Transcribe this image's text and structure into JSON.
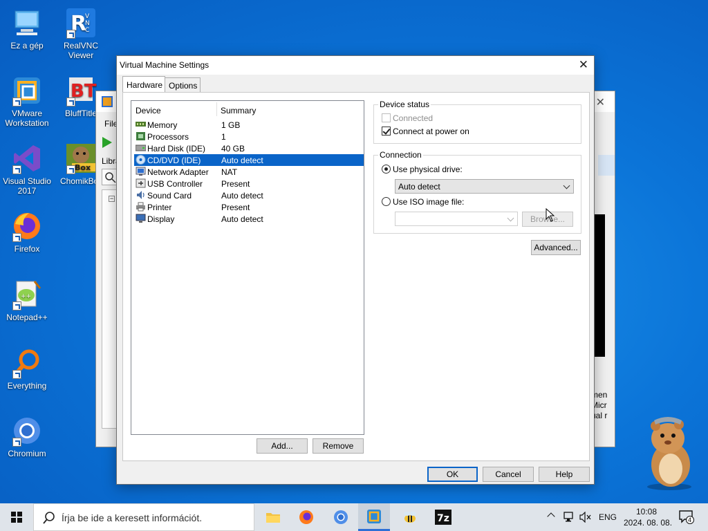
{
  "desktop": {
    "icons": [
      {
        "label": "Ez a gép"
      },
      {
        "label": "RealVNC Viewer"
      },
      {
        "label": "VMware Workstation"
      },
      {
        "label": "BluffTitle"
      },
      {
        "label": "Visual Studio 2017"
      },
      {
        "label": "ChomikBo"
      },
      {
        "label": "Firefox"
      },
      {
        "label": "Notepad++"
      },
      {
        "label": "Everything"
      },
      {
        "label": "Chromium"
      }
    ]
  },
  "background_window": {
    "menu_file": "File",
    "library_label": "Libra",
    "side_text": "men Micr ual r"
  },
  "dialog": {
    "title": "Virtual Machine Settings",
    "tabs": [
      {
        "label": "Hardware"
      },
      {
        "label": "Options"
      }
    ],
    "device_list": {
      "headers": {
        "device": "Device",
        "summary": "Summary"
      },
      "rows": [
        {
          "device": "Memory",
          "summary": "1 GB"
        },
        {
          "device": "Processors",
          "summary": "1"
        },
        {
          "device": "Hard Disk (IDE)",
          "summary": "40 GB"
        },
        {
          "device": "CD/DVD (IDE)",
          "summary": "Auto detect"
        },
        {
          "device": "Network Adapter",
          "summary": "NAT"
        },
        {
          "device": "USB Controller",
          "summary": "Present"
        },
        {
          "device": "Sound Card",
          "summary": "Auto detect"
        },
        {
          "device": "Printer",
          "summary": "Present"
        },
        {
          "device": "Display",
          "summary": "Auto detect"
        }
      ],
      "selected": "CD/DVD (IDE)"
    },
    "add_button": "Add...",
    "remove_button": "Remove",
    "device_status": {
      "label": "Device status",
      "connected": "Connected",
      "connect_at_power_on": "Connect at power on"
    },
    "connection": {
      "label": "Connection",
      "use_physical_drive": "Use physical drive:",
      "physical_drive_value": "Auto detect",
      "use_iso_image": "Use ISO image file:",
      "iso_value": "",
      "browse_button": "Browse..."
    },
    "advanced_button": "Advanced...",
    "ok_button": "OK",
    "cancel_button": "Cancel",
    "help_button": "Help"
  },
  "taskbar": {
    "search_placeholder": "Írja be ide a keresett információt.",
    "language": "ENG",
    "time": "10:08",
    "date": "2024. 08. 08.",
    "notification_count": "4"
  },
  "colors": {
    "selection": "#0a64c8",
    "desktop_bg": "#0b74d8"
  }
}
